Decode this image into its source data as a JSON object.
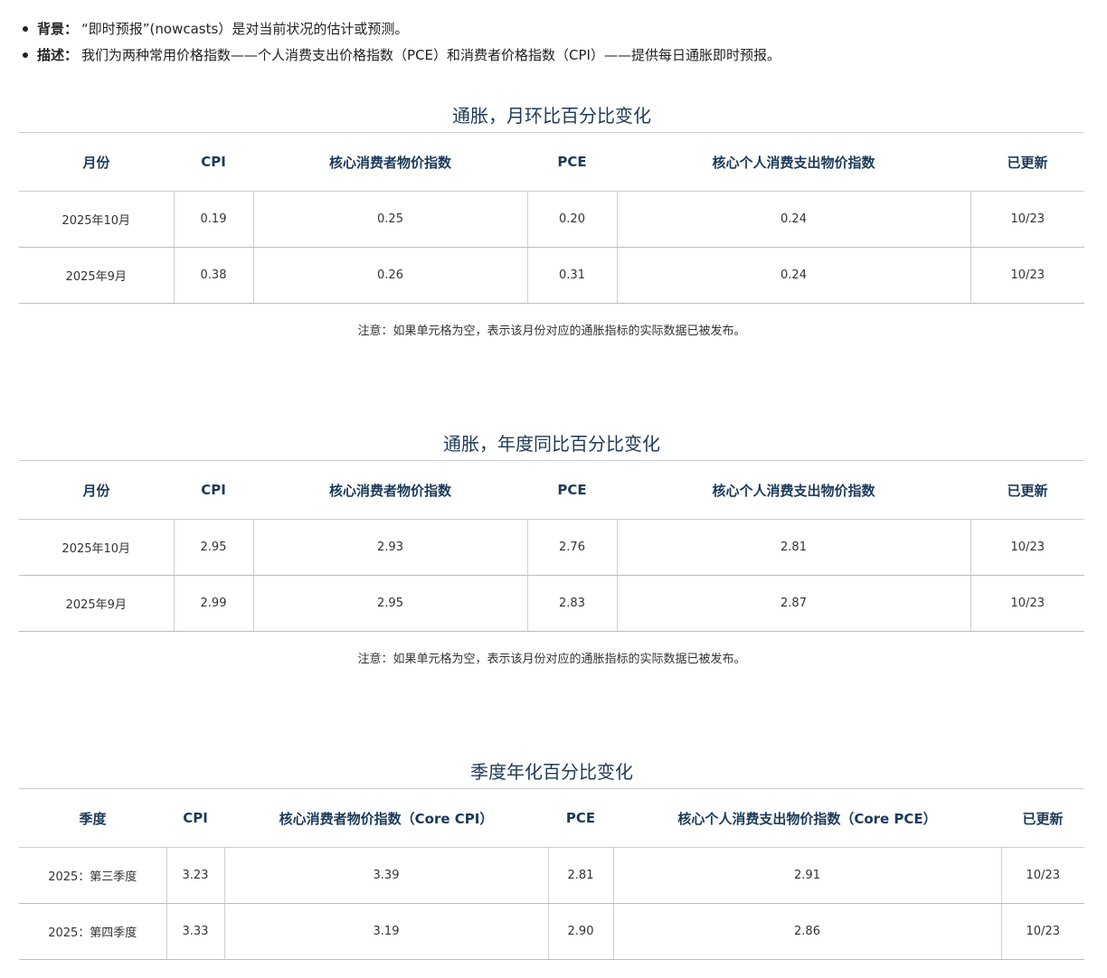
{
  "intro": {
    "items": [
      {
        "label": "背景：",
        "text": "“即时预报”(nowcasts）是对当前状况的估计或预测。"
      },
      {
        "label": "描述：",
        "text": "我们为两种常用价格指数——个人消费支出价格指数（PCE）和消费者价格指数（CPI）——提供每日通胀即时预报。"
      }
    ]
  },
  "tables": [
    {
      "title": "通胀，月环比百分比变化",
      "headers": [
        "月份",
        "CPI",
        "核心消费者物价指数",
        "PCE",
        "核心个人消费支出物价指数",
        "已更新"
      ],
      "rows": [
        [
          "2025年10月",
          "0.19",
          "0.25",
          "0.20",
          "0.24",
          "10/23"
        ],
        [
          "2025年9月",
          "0.38",
          "0.26",
          "0.31",
          "0.24",
          "10/23"
        ]
      ],
      "note": "注意：如果单元格为空，表示该月份对应的通胀指标的实际数据已被发布。"
    },
    {
      "title": "通胀，年度同比百分比变化",
      "headers": [
        "月份",
        "CPI",
        "核心消费者物价指数",
        "PCE",
        "核心个人消费支出物价指数",
        "已更新"
      ],
      "rows": [
        [
          "2025年10月",
          "2.95",
          "2.93",
          "2.76",
          "2.81",
          "10/23"
        ],
        [
          "2025年9月",
          "2.99",
          "2.95",
          "2.83",
          "2.87",
          "10/23"
        ]
      ],
      "note": "注意：如果单元格为空，表示该月份对应的通胀指标的实际数据已被发布。"
    },
    {
      "title": "季度年化百分比变化",
      "headers": [
        "季度",
        "CPI",
        "核心消费者物价指数（Core CPI）",
        "PCE",
        "核心个人消费支出物价指数（Core PCE）",
        "已更新"
      ],
      "rows": [
        [
          "2025：第三季度",
          "3.23",
          "3.39",
          "2.81",
          "2.91",
          "10/23"
        ],
        [
          "2025：第四季度",
          "3.33",
          "3.19",
          "2.90",
          "2.86",
          "10/23"
        ]
      ]
    }
  ]
}
